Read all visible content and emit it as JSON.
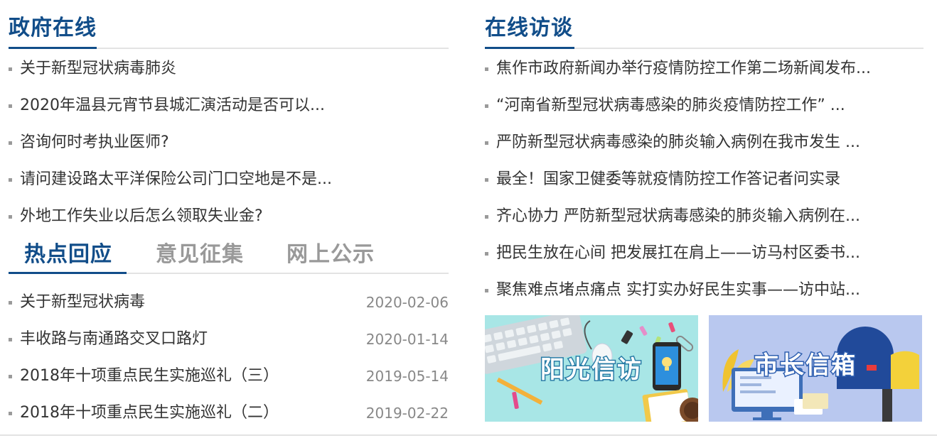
{
  "gov_online": {
    "title": "政府在线",
    "items": [
      "关于新型冠状病毒肺炎",
      "2020年温县元宵节县城汇演活动是否可以...",
      "咨询何时考执业医师?",
      "请问建设路太平洋保险公司门口空地是不是...",
      "外地工作失业以后怎么领取失业金?"
    ]
  },
  "tabs": {
    "items": [
      "热点回应",
      "意见征集",
      "网上公示"
    ],
    "active": "热点回应"
  },
  "hot_response": {
    "items": [
      {
        "title": "关于新型冠状病毒",
        "date": "2020-02-06"
      },
      {
        "title": "丰收路与南通路交叉口路灯",
        "date": "2020-01-14"
      },
      {
        "title": "2018年十项重点民生实施巡礼（三）",
        "date": "2019-05-14"
      },
      {
        "title": "2018年十项重点民生实施巡礼（二）",
        "date": "2019-02-22"
      }
    ]
  },
  "interview": {
    "title": "在线访谈",
    "items": [
      "焦作市政府新闻办举行疫情防控工作第二场新闻发布...",
      "“河南省新型冠状病毒感染的肺炎疫情防控工作” ...",
      "严防新型冠状病毒感染的肺炎输入病例在我市发生 ...",
      "最全！国家卫健委等就疫情防控工作答记者问实录",
      "齐心协力 严防新型冠状病毒感染的肺炎输入病例在...",
      "把民生放在心间 把发展扛在肩上——访马村区委书...",
      "聚焦难点堵点痛点 实打实办好民生实事——访中站..."
    ]
  },
  "banners": {
    "sunshine_petition": "阳光信访",
    "mayor_mailbox": "市长信箱"
  },
  "colors": {
    "brand_blue": "#114d89",
    "inactive_tab": "#999999",
    "divider": "#e3e3e3",
    "banner1_bg": "#a8e6e6",
    "banner2_bg": "#b9c8ef"
  }
}
